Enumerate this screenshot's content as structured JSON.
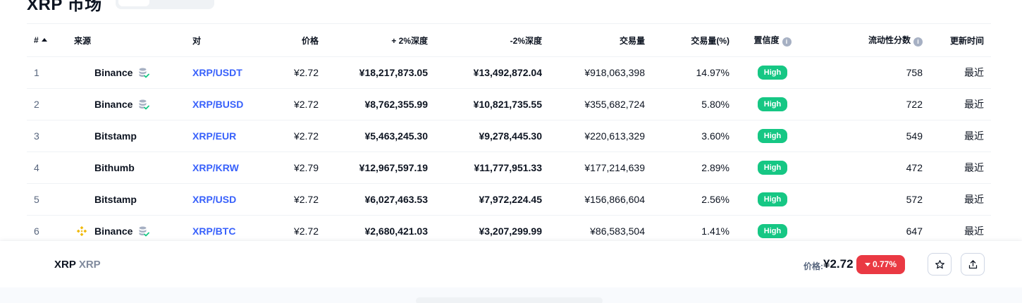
{
  "header": {
    "title": "XRP 市场"
  },
  "table": {
    "columns": {
      "rank": "#",
      "source": "来源",
      "pair": "对",
      "price": "价格",
      "plus_depth": "+ 2%深度",
      "minus_depth": "-2%深度",
      "volume": "交易量",
      "volume_pct": "交易量(%)",
      "confidence": "置信度",
      "liquidity": "流动性分数",
      "updated": "更新时间"
    },
    "info_icon_glyph": "i",
    "rows": [
      {
        "rank": "1",
        "exchange": "Binance",
        "logo": "none",
        "db_icon": true,
        "pair": "XRP/USDT",
        "price": "¥2.72",
        "plus_depth": "¥18,217,873.05",
        "minus_depth": "¥13,492,872.04",
        "volume": "¥918,063,398",
        "volume_pct": "14.97%",
        "confidence": "High",
        "liquidity": "758",
        "updated": "最近"
      },
      {
        "rank": "2",
        "exchange": "Binance",
        "logo": "none",
        "db_icon": true,
        "pair": "XRP/BUSD",
        "price": "¥2.72",
        "plus_depth": "¥8,762,355.99",
        "minus_depth": "¥10,821,735.55",
        "volume": "¥355,682,724",
        "volume_pct": "5.80%",
        "confidence": "High",
        "liquidity": "722",
        "updated": "最近"
      },
      {
        "rank": "3",
        "exchange": "Bitstamp",
        "logo": "none",
        "db_icon": false,
        "pair": "XRP/EUR",
        "price": "¥2.72",
        "plus_depth": "¥5,463,245.30",
        "minus_depth": "¥9,278,445.30",
        "volume": "¥220,613,329",
        "volume_pct": "3.60%",
        "confidence": "High",
        "liquidity": "549",
        "updated": "最近"
      },
      {
        "rank": "4",
        "exchange": "Bithumb",
        "logo": "none",
        "db_icon": false,
        "pair": "XRP/KRW",
        "price": "¥2.79",
        "plus_depth": "¥12,967,597.19",
        "minus_depth": "¥11,777,951.33",
        "volume": "¥177,214,639",
        "volume_pct": "2.89%",
        "confidence": "High",
        "liquidity": "472",
        "updated": "最近"
      },
      {
        "rank": "5",
        "exchange": "Bitstamp",
        "logo": "none",
        "db_icon": false,
        "pair": "XRP/USD",
        "price": "¥2.72",
        "plus_depth": "¥6,027,463.53",
        "minus_depth": "¥7,972,224.45",
        "volume": "¥156,866,604",
        "volume_pct": "2.56%",
        "confidence": "High",
        "liquidity": "572",
        "updated": "最近"
      },
      {
        "rank": "6",
        "exchange": "Binance",
        "logo": "binance-logo",
        "db_icon": true,
        "pair": "XRP/BTC",
        "price": "¥2.72",
        "plus_depth": "¥2,680,421.03",
        "minus_depth": "¥3,207,299.99",
        "volume": "¥86,583,504",
        "volume_pct": "1.41%",
        "confidence": "High",
        "liquidity": "647",
        "updated": "最近"
      }
    ]
  },
  "sticky_bar": {
    "coin_name": "XRP",
    "coin_symbol": "XRP",
    "price_label": "价格:",
    "price": "¥2.72",
    "change": "0.77%",
    "change_direction": "down",
    "star_icon": "star-icon",
    "share_icon": "share-icon"
  },
  "colors": {
    "link": "#3861fb",
    "high_badge": "#16c784",
    "negative": "#ea3943",
    "binance_yellow": "#f0b90b",
    "db_icon_gray": "#a6b0c3",
    "db_check_green": "#16c784"
  }
}
